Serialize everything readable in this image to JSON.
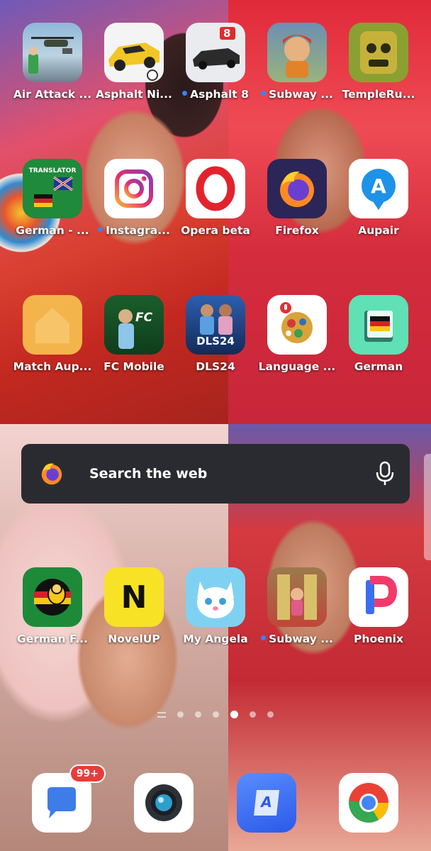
{
  "home": {
    "rows": [
      [
        {
          "name": "Air Attack ...",
          "icon": "air-attack-icon",
          "dot": false
        },
        {
          "name": "Asphalt Ni...",
          "icon": "asphalt-nitro-icon",
          "dot": false
        },
        {
          "name": "Asphalt 8",
          "icon": "asphalt-8-icon",
          "dot": true
        },
        {
          "name": "Subway ...",
          "icon": "subway-surfers-icon",
          "dot": true
        },
        {
          "name": "TempleRu...",
          "icon": "temple-run-icon",
          "dot": false
        }
      ],
      [
        {
          "name": "German - ...",
          "icon": "translator-icon",
          "dot": false,
          "tile_text": "TRANSLATOR"
        },
        {
          "name": "Instagra...",
          "icon": "instagram-icon",
          "dot": true
        },
        {
          "name": "Opera beta",
          "icon": "opera-icon",
          "dot": false
        },
        {
          "name": "Firefox",
          "icon": "firefox-icon",
          "dot": false
        },
        {
          "name": "Aupair",
          "icon": "aupair-icon",
          "dot": false,
          "tile_text": "A"
        }
      ],
      [
        {
          "name": "Match Aup...",
          "icon": "match-aupair-icon",
          "dot": false
        },
        {
          "name": "FC Mobile",
          "icon": "fc-mobile-icon",
          "dot": false,
          "tile_text": "FC"
        },
        {
          "name": "DLS24",
          "icon": "dls24-icon",
          "dot": false,
          "tile_text": "DLS24"
        },
        {
          "name": "Language ...",
          "icon": "language-globe-icon",
          "dot": false
        },
        {
          "name": "German",
          "icon": "german-book-icon",
          "dot": false
        }
      ],
      [
        {
          "name": "German F...",
          "icon": "german-bee-icon",
          "dot": false
        },
        {
          "name": "NovelUP",
          "icon": "novelup-icon",
          "dot": false,
          "tile_text": "N"
        },
        {
          "name": "My Angela",
          "icon": "my-angela-icon",
          "dot": false
        },
        {
          "name": "Subway ...",
          "icon": "subway-princess-icon",
          "dot": true
        },
        {
          "name": "Phoenix",
          "icon": "phoenix-icon",
          "dot": false,
          "tile_text": "P"
        }
      ]
    ]
  },
  "search": {
    "placeholder": "Search the web",
    "left_icon": "firefox-icon",
    "right_icon": "microphone-icon"
  },
  "asphalt8_tile_text": "8",
  "pager": {
    "pages": 6,
    "active_index": 3
  },
  "dock": {
    "messages_badge": "99+",
    "apps": [
      "messages-icon",
      "camera-icon",
      "notes-icon",
      "chrome-icon"
    ],
    "notes_tile_text": "A"
  },
  "colors": {
    "search_bg": "#2a2b31",
    "dot_blue": "#3a82f7",
    "badge_red": "#ea3b3b"
  }
}
